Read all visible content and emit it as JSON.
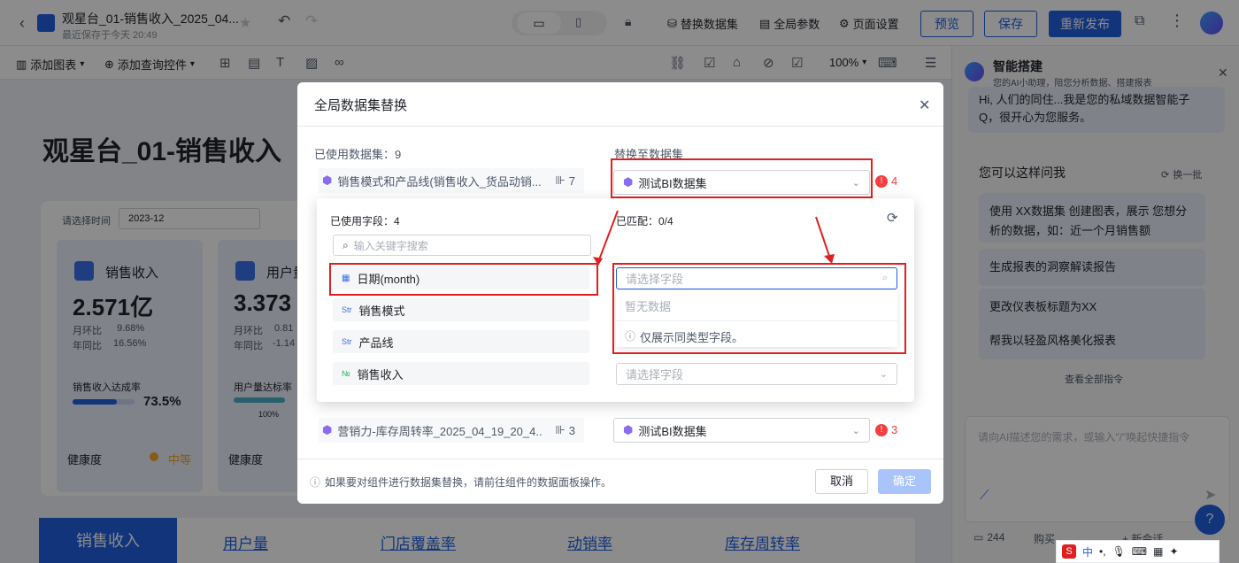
{
  "topbar": {
    "title": "观星台_01-销售收入_2025_04...",
    "subtitle": "最近保存于今天 20:49",
    "replace_dataset": "替换数据集",
    "global_params": "全局参数",
    "page_settings": "页面设置",
    "preview": "预览",
    "save": "保存",
    "republish": "重新发布"
  },
  "toolbar": {
    "add_chart": "添加图表",
    "add_query": "添加查询控件",
    "zoom": "100%"
  },
  "canvas": {
    "title": "观星台_01-销售收入",
    "select_time_label": "请选择时间",
    "time_value": "2023-12",
    "kpis": [
      {
        "name": "销售收入",
        "value": "2.571亿",
        "mom_label": "月环比",
        "mom": "9.68%",
        "yoy_label": "年同比",
        "yoy": "16.56%",
        "rate_label": "销售收入达成率",
        "rate": "73.5%",
        "health_label": "健康度",
        "health": "中等"
      },
      {
        "name": "用户量",
        "value": "3.373",
        "mom_label": "月环比",
        "mom": "0.81",
        "yoy_label": "年同比",
        "yoy": "-1.14",
        "rate_label": "用户量达标率",
        "rate": "100%",
        "health_label": "健康度",
        "health": ""
      }
    ],
    "tabs": [
      "销售收入",
      "用户量",
      "门店覆盖率",
      "动销率",
      "库存周转率"
    ]
  },
  "ai": {
    "title": "智能搭建",
    "subtitle": "您的AI小助理，陪您分析数据、搭建报表",
    "greeting_partial": "Hi, 人们的同住...我是您的私域数据智能子",
    "greeting_end": "Q，很开心为您服务。",
    "ask_title": "您可以这样问我",
    "refresh": "换一批",
    "suggestions": [
      "使用 XX数据集 创建图表，展示 您想分析的数据，如：近一个月销售额",
      "生成报表的洞察解读报告",
      "更改仪表板标题为XX",
      "帮我以轻盈风格美化报表"
    ],
    "view_all": "查看全部指令",
    "input_placeholder": "请向AI描述您的需求，或输入\"/\"唤起快捷指令",
    "count": "244",
    "buy": "购买",
    "new_chat": "+ 新会话"
  },
  "modal": {
    "title": "全局数据集替换",
    "used_label": "已使用数据集：9",
    "replace_to_label": "替换至数据集",
    "rows": [
      {
        "source": "销售模式和产品线(销售收入_货品动销...",
        "count": "7",
        "target": "测试BI数据集",
        "warn": "4"
      },
      {
        "source": "营销力-库存周转率_2025_04_19_20_4...",
        "count": "3",
        "target": "测试BI数据集",
        "warn": "3"
      }
    ],
    "footer_note": "如果要对组件进行数据集替换，请前往组件的数据面板操作。",
    "cancel": "取消",
    "confirm": "确定"
  },
  "popup": {
    "used_fields": "已使用字段：4",
    "matched": "已匹配：0/4",
    "search_placeholder": "输入关键字搜索",
    "fields": [
      {
        "name": "日期(month)",
        "type": "date"
      },
      {
        "name": "销售模式",
        "type": "str"
      },
      {
        "name": "产品线",
        "type": "str"
      },
      {
        "name": "销售收入",
        "type": "num"
      }
    ],
    "select_placeholder": "请选择字段",
    "no_data": "暂无数据",
    "hint": "仅展示同类型字段。"
  },
  "colors": {
    "accent": "#1f5fe0",
    "danger": "#e02020",
    "warn": "#f53f3f"
  }
}
